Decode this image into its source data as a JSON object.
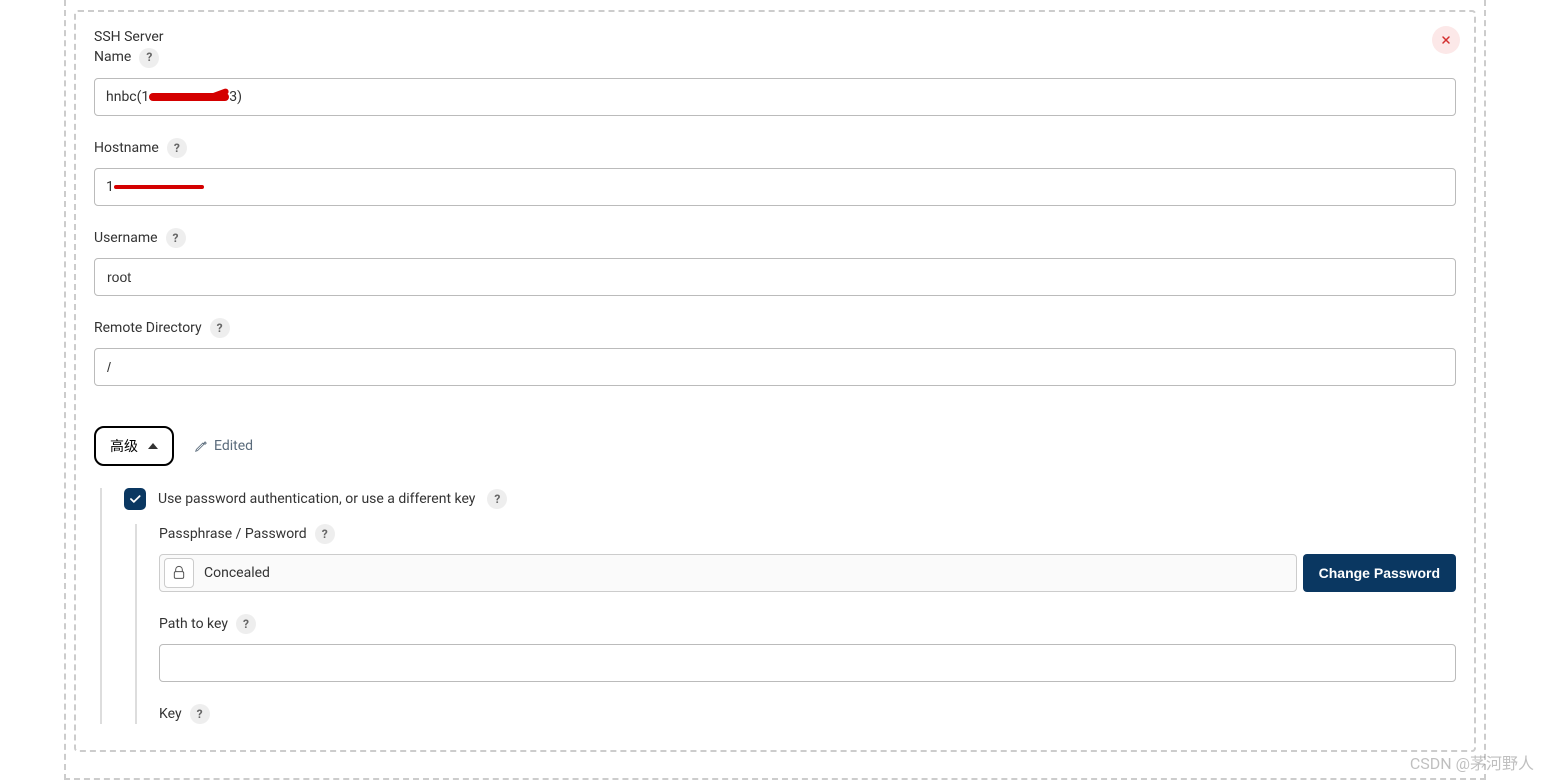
{
  "labels": {
    "ssh_server_name_line1": "SSH Server",
    "ssh_server_name_line2": "Name",
    "hostname": "Hostname",
    "username": "Username",
    "remote_directory": "Remote Directory",
    "advanced": "高级",
    "edited": "Edited",
    "use_password_auth": "Use password authentication, or use a different key",
    "passphrase": "Passphrase / Password",
    "concealed": "Concealed",
    "change_password": "Change Password",
    "path_to_key": "Path to key",
    "key": "Key",
    "help": "?"
  },
  "values": {
    "ssh_server_name_prefix": "hnbc(1",
    "ssh_server_name_suffix": "3)",
    "hostname_prefix": "1",
    "username": "root",
    "remote_directory": "/",
    "path_to_key": "",
    "use_password_auth_checked": true
  },
  "watermark": "CSDN @茅河野人"
}
